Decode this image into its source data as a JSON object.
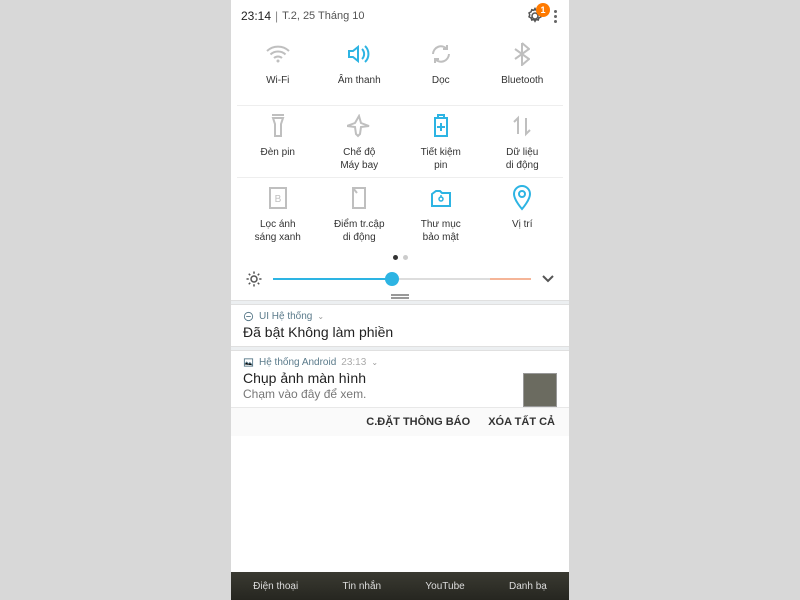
{
  "status": {
    "time": "23:14",
    "date": "T.2, 25 Tháng 10",
    "badge": "1"
  },
  "toggles": [
    {
      "label": "Wi-Fi"
    },
    {
      "label": "Âm thanh"
    },
    {
      "label": "Dọc"
    },
    {
      "label": "Bluetooth"
    },
    {
      "label": "Đèn pin"
    },
    {
      "label": "Chế độ\nMáy bay"
    },
    {
      "label": "Tiết kiệm\npin"
    },
    {
      "label": "Dữ liệu\ndi động"
    },
    {
      "label": "Lọc ánh\nsáng xanh"
    },
    {
      "label": "Điểm tr.cập\ndi động"
    },
    {
      "label": "Thư mục\nbảo mật"
    },
    {
      "label": "Vị trí"
    }
  ],
  "notif1": {
    "app": "UI Hệ thống",
    "title": "Đã bật Không làm phiền"
  },
  "notif2": {
    "app": "Hệ thống Android",
    "time": "23:13",
    "title": "Chụp ảnh màn hình",
    "sub": "Chạm vào đây để xem."
  },
  "actions": {
    "settings": "C.ĐẶT THÔNG BÁO",
    "clear": "XÓA TẤT CẢ"
  },
  "dock": [
    "Điện thoại",
    "Tin nhắn",
    "YouTube",
    "Danh bạ"
  ]
}
